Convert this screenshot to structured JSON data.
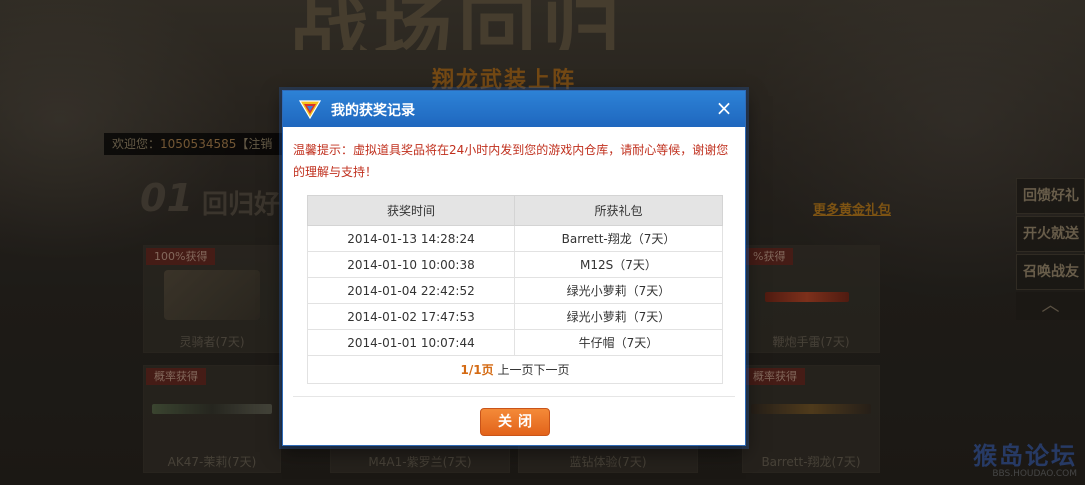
{
  "background": {
    "banner_title": "战场回归",
    "banner_subtitle": "翔龙武装上阵",
    "welcome_prefix": "欢迎您：",
    "user_id": "1050534585",
    "logout": "【注销",
    "section_number": "01",
    "section_title": "回归好",
    "more_link": "更多黄金礼包",
    "cards_top": [
      {
        "tag": "100%获得",
        "caption": "灵骑者(7天)"
      },
      {
        "tag": "%获得",
        "caption": "鞭炮手雷(7天)"
      }
    ],
    "cards_bottom": [
      {
        "tag": "概率获得",
        "caption": "AK47-茉莉(7天)"
      },
      {
        "tag": "",
        "caption": "M4A1-紫罗兰(7天)"
      },
      {
        "tag": "",
        "caption": "蓝钻体验(7天)"
      },
      {
        "tag": "概率获得",
        "caption": "Barrett-翔龙(7天)"
      }
    ],
    "side_menu": [
      "回馈好礼",
      "开火就送",
      "召唤战友"
    ],
    "watermark_main": "猴岛论坛",
    "watermark_url": "BBS.HOUDAO.COM"
  },
  "modal": {
    "title": "我的获奖记录",
    "close_icon": "×",
    "tip": "温馨提示：虚拟道具奖品将在24小时内发到您的游戏内仓库，请耐心等候，谢谢您的理解与支持！",
    "table": {
      "headers": [
        "获奖时间",
        "所获礼包"
      ],
      "rows": [
        [
          "2014-01-13 14:28:24",
          "Barrett-翔龙（7天）"
        ],
        [
          "2014-01-10 10:00:38",
          "M12S（7天）"
        ],
        [
          "2014-01-04 22:42:52",
          "绿光小萝莉（7天）"
        ],
        [
          "2014-01-02 17:47:53",
          "绿光小萝莉（7天）"
        ],
        [
          "2014-01-01 10:07:44",
          "牛仔帽（7天）"
        ]
      ]
    },
    "pager": {
      "current": "1/1页",
      "prev": "上一页",
      "next": "下一页"
    },
    "close_button": "关闭"
  },
  "colors": {
    "modal_header": "#2d82d6",
    "tip_text": "#c0301e",
    "button": "#f07a2a",
    "pager_current": "#d46a13"
  }
}
